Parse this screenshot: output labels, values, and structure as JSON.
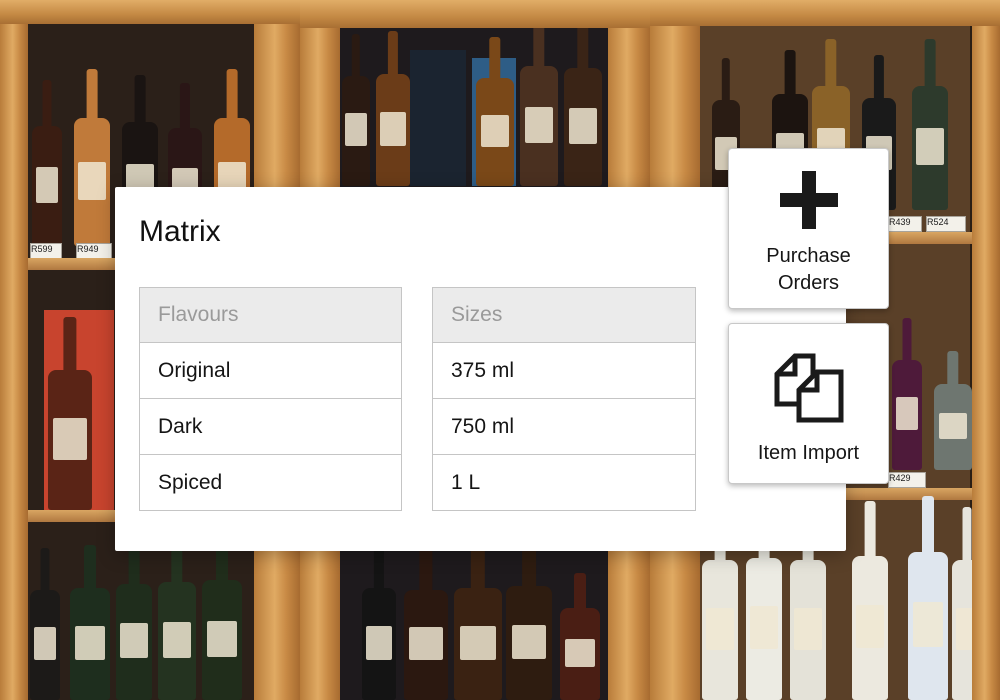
{
  "matrix": {
    "title": "Matrix",
    "flavours": {
      "header": "Flavours",
      "rows": [
        "Original",
        "Dark",
        "Spiced"
      ]
    },
    "sizes": {
      "header": "Sizes",
      "rows": [
        "375 ml",
        "750 ml",
        "1 L"
      ]
    }
  },
  "actions": {
    "purchase_orders": {
      "label": "Purchase Orders",
      "icon": "plus-icon"
    },
    "item_import": {
      "label": "Item Import",
      "icon": "documents-icon"
    }
  },
  "background": {
    "description_icon": "liquor-shelf-photo",
    "price_tags": [
      "R599",
      "R949",
      "R439",
      "R524",
      "R429"
    ]
  },
  "colors": {
    "card": "#ffffff",
    "header_bg": "#ebebeb",
    "header_text": "#9a9a9a",
    "border": "#c5c5c5",
    "wood": "#c9934f"
  }
}
